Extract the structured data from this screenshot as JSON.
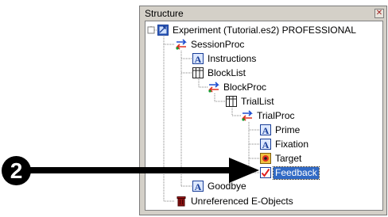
{
  "window": {
    "title": "Structure",
    "close_glyph": "✕"
  },
  "tree": {
    "root": "Experiment (Tutorial.es2) PROFESSIONAL",
    "session_proc": "SessionProc",
    "instructions": "Instructions",
    "block_list": "BlockList",
    "block_proc": "BlockProc",
    "trial_list": "TrialList",
    "trial_proc": "TrialProc",
    "prime": "Prime",
    "fixation": "Fixation",
    "target": "Target",
    "feedback": "Feedback",
    "goodbye": "Goodbye",
    "unreferenced": "Unreferenced E-Objects"
  },
  "selected_item": "Feedback",
  "annotation": {
    "step_number": "2"
  },
  "icons": {
    "root": "experiment-icon",
    "procedure": "procedure-icon",
    "text_display": "text-display-icon",
    "list": "list-icon",
    "image_display": "image-display-icon",
    "feedback_display": "feedback-display-icon",
    "unreferenced": "trash-icon"
  },
  "colors": {
    "selection": "#316ac5",
    "window_chrome": "#d4d0c8"
  }
}
